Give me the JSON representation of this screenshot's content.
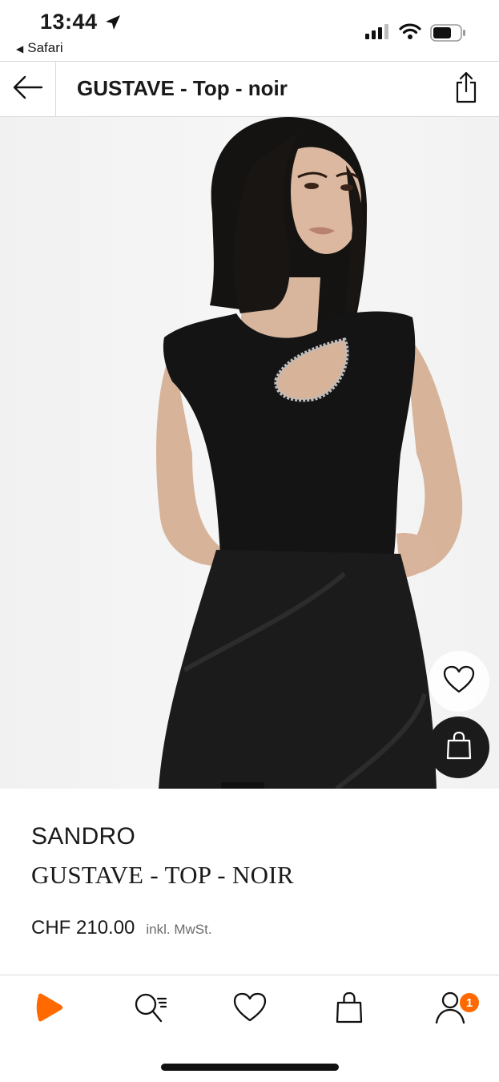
{
  "status_bar": {
    "time": "13:44",
    "back_app": "Safari",
    "icons": [
      "location-arrow-icon",
      "signal-icon",
      "wifi-icon",
      "battery-icon"
    ]
  },
  "nav": {
    "title": "GUSTAVE - Top - noir",
    "back_icon": "arrow-left-icon",
    "share_icon": "share-icon"
  },
  "product": {
    "brand": "SANDRO",
    "name": "GUSTAVE - TOP - NOIR",
    "price": "CHF 210.00",
    "tax_note": "inkl. MwSt.",
    "actions": [
      "heart-icon",
      "shopping-bag-icon"
    ]
  },
  "tab_bar": {
    "items": [
      "zalando-logo-icon",
      "search-list-icon",
      "heart-icon",
      "shopping-bag-icon",
      "profile-icon"
    ],
    "profile_badge": "1"
  },
  "colors": {
    "accent": "#ff6900",
    "text": "#1a1a1a",
    "muted": "#6b6b6b",
    "image_bg": "#f3f3f3",
    "dark_fab": "#1b1b1b"
  }
}
